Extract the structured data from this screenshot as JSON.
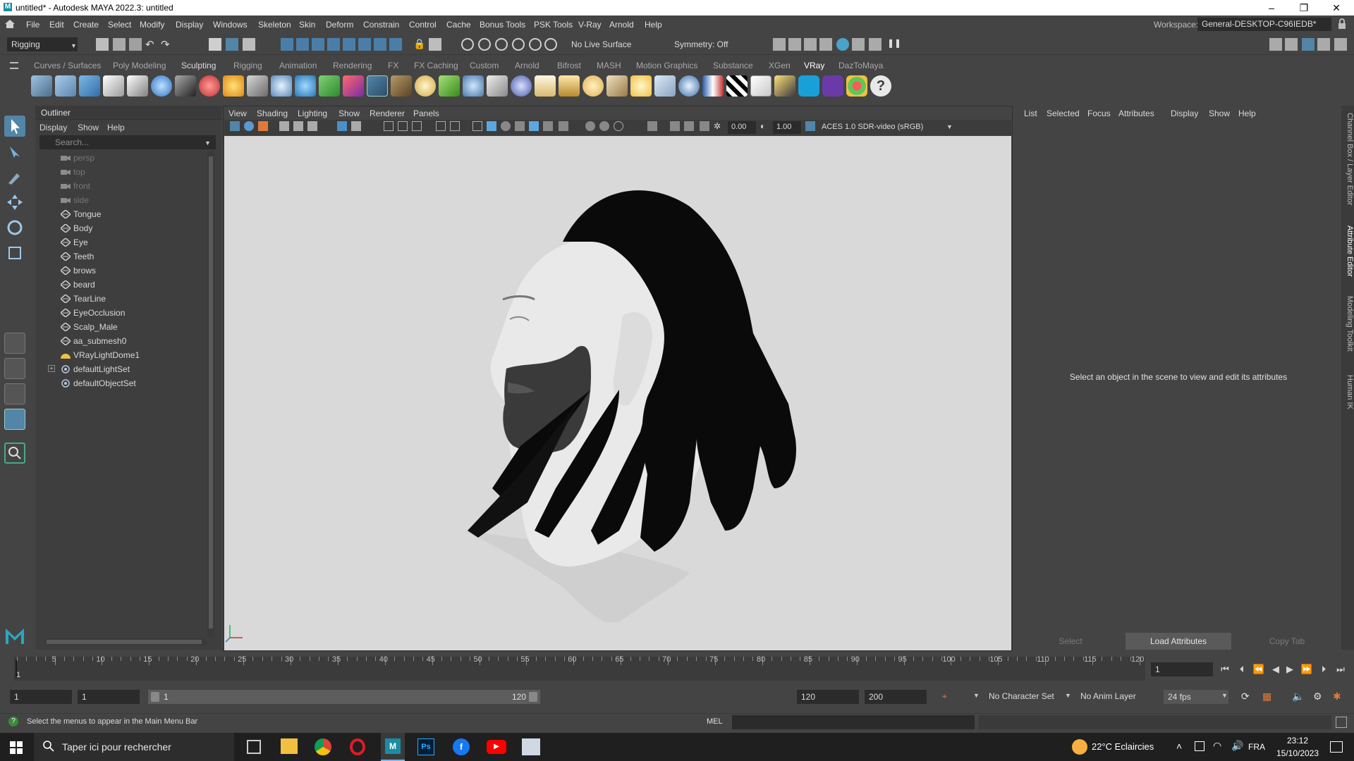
{
  "window": {
    "title": "untitled* - Autodesk MAYA 2022.3: untitled",
    "minimize": "–",
    "maximize": "❐",
    "close": "✕"
  },
  "menubar": {
    "items": [
      "File",
      "Edit",
      "Create",
      "Select",
      "Modify",
      "Display",
      "Windows",
      "Skeleton",
      "Skin",
      "Deform",
      "Constrain",
      "Control",
      "Cache",
      "Bonus Tools",
      "PSK Tools",
      "V-Ray",
      "Arnold",
      "Help"
    ],
    "workspace_label": "Workspace:",
    "workspace_value": "General-DESKTOP-C96IEDB*"
  },
  "statusline": {
    "mode": "Rigging",
    "live_surface": "No Live Surface",
    "symmetry": "Symmetry: Off"
  },
  "shelf": {
    "tabs": [
      "Curves / Surfaces",
      "Poly Modeling",
      "Sculpting",
      "Rigging",
      "Animation",
      "Rendering",
      "FX",
      "FX Caching",
      "Custom",
      "Arnold",
      "Bifrost",
      "MASH",
      "Motion Graphics",
      "Substance",
      "XGen",
      "VRay",
      "DazToMaya"
    ],
    "active_tab": "VRay"
  },
  "outliner": {
    "title": "Outliner",
    "menus": [
      "Display",
      "Show",
      "Help"
    ],
    "search_placeholder": "Search...",
    "items": [
      {
        "label": "persp",
        "type": "camera",
        "dim": true
      },
      {
        "label": "top",
        "type": "camera",
        "dim": true
      },
      {
        "label": "front",
        "type": "camera",
        "dim": true
      },
      {
        "label": "side",
        "type": "camera",
        "dim": true
      },
      {
        "label": "Tongue",
        "type": "mesh"
      },
      {
        "label": "Body",
        "type": "mesh"
      },
      {
        "label": "Eye",
        "type": "mesh"
      },
      {
        "label": "Teeth",
        "type": "mesh"
      },
      {
        "label": "brows",
        "type": "mesh"
      },
      {
        "label": "beard",
        "type": "mesh"
      },
      {
        "label": "TearLine",
        "type": "mesh"
      },
      {
        "label": "EyeOcclusion",
        "type": "mesh"
      },
      {
        "label": "Scalp_Male",
        "type": "mesh"
      },
      {
        "label": "aa_submesh0",
        "type": "mesh"
      },
      {
        "label": "VRayLightDome1",
        "type": "light"
      },
      {
        "label": "defaultLightSet",
        "type": "set",
        "expandable": true
      },
      {
        "label": "defaultObjectSet",
        "type": "set"
      }
    ]
  },
  "viewport": {
    "menus": [
      "View",
      "Shading",
      "Lighting",
      "Show",
      "Renderer",
      "Panels"
    ],
    "field1": "0.00",
    "field2": "1.00",
    "colorspace": "ACES 1.0 SDR-video (sRGB)"
  },
  "attribute_editor": {
    "menus": [
      "List",
      "Selected",
      "Focus",
      "Attributes",
      "Display",
      "Show",
      "Help"
    ],
    "message": "Select an object in the scene to view and edit its attributes",
    "buttons": {
      "select": "Select",
      "load": "Load Attributes",
      "copy": "Copy Tab"
    }
  },
  "right_tabs": [
    "Channel Box / Layer Editor",
    "Attribute Editor",
    "Modeling Toolkit",
    "Human IK"
  ],
  "timeslider": {
    "ticks": [
      "5",
      "10",
      "15",
      "20",
      "25",
      "30",
      "35",
      "40",
      "45",
      "50",
      "55",
      "60",
      "65",
      "70",
      "75",
      "80",
      "85",
      "90",
      "95",
      "100",
      "105",
      "110",
      "115",
      "120"
    ],
    "start_marker": "1",
    "current_frame": "1"
  },
  "range": {
    "start": "1",
    "playback_start": "1",
    "slider_start": "1",
    "slider_end": "120",
    "playback_end": "120",
    "end": "200",
    "character_set": "No Character Set",
    "anim_layer": "No Anim Layer",
    "fps": "24 fps"
  },
  "helpline": {
    "text": "Select the menus to appear in the Main Menu Bar",
    "mel_label": "MEL"
  },
  "taskbar": {
    "search_placeholder": "Taper ici pour rechercher",
    "weather": "22°C  Eclaircies",
    "lang": "FRA",
    "time": "23:12",
    "date": "15/10/2023"
  },
  "colors": {
    "maya_bg": "#444444",
    "viewport_bg": "#d9d9d9",
    "accent": "#5285a6"
  }
}
